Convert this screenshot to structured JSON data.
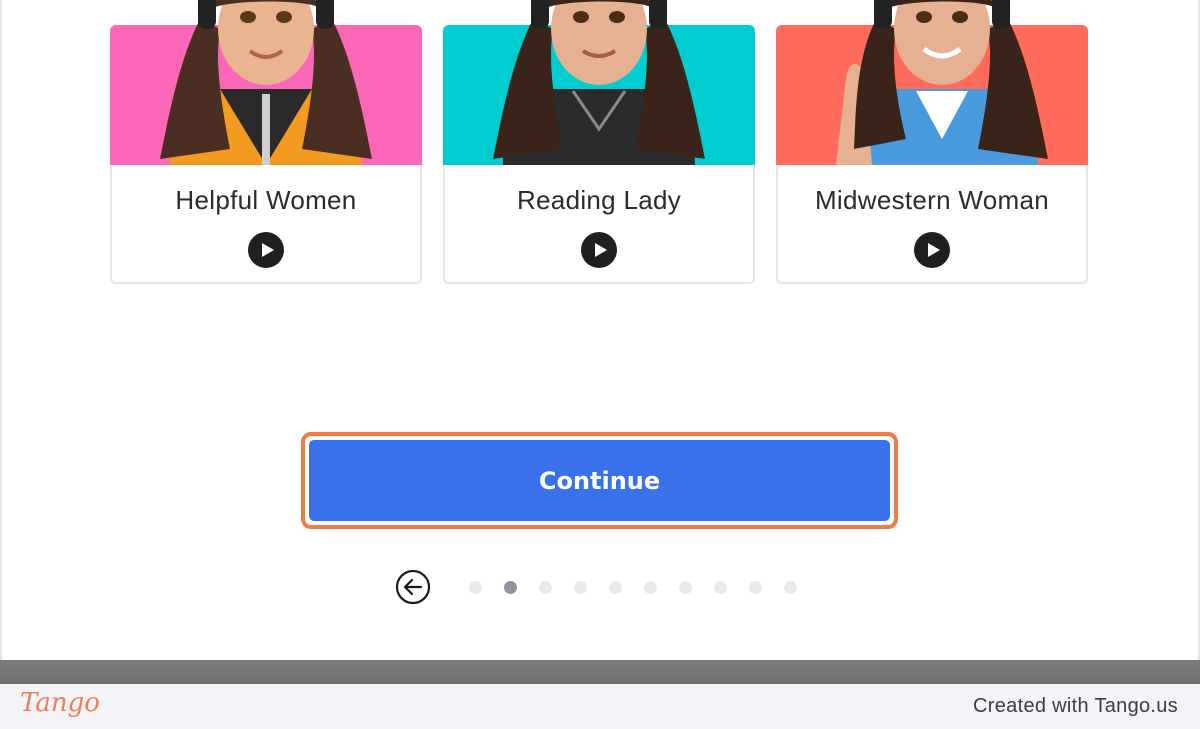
{
  "cards": [
    {
      "title": "Helpful Women",
      "bg": "#fd67b7",
      "jacket": "#f39a21",
      "play_label": "play-icon"
    },
    {
      "title": "Reading Lady",
      "bg": "#00cdd0",
      "jacket": "#2b2b2e",
      "play_label": "play-icon"
    },
    {
      "title": "Midwestern Woman",
      "bg": "#ff6c5c",
      "jacket": "#4a9bde",
      "play_label": "play-icon"
    }
  ],
  "continue_label": "Continue",
  "pager": {
    "total": 10,
    "active_index": 1,
    "back_icon": "arrow-left-circle-icon"
  },
  "footer": {
    "logo": "Tango",
    "credit": "Created with Tango.us"
  },
  "colors": {
    "accent": "#3871ea",
    "highlight": "#f07b45",
    "dot": "#e8e9ec",
    "dot_active": "#8e949c"
  }
}
